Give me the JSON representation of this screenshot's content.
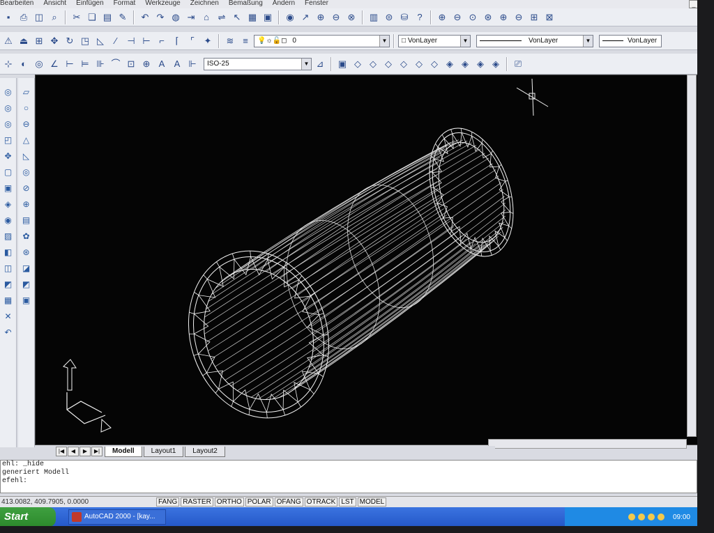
{
  "menu": [
    "Bearbeiten",
    "Ansicht",
    "Einfügen",
    "Format",
    "Werkzeuge",
    "Zeichnen",
    "Bemaßung",
    "Ändern",
    "Fenster"
  ],
  "toolbar": {
    "layer_icons": "💡☼🔓◻",
    "layer_value": "0",
    "color_value": "□ VonLayer",
    "linetype_value": "VonLayer",
    "lineweight_value": "VonLayer",
    "dimstyle_value": "ISO-25"
  },
  "tabs": [
    "Modell",
    "Layout1",
    "Layout2"
  ],
  "command": {
    "lines": [
      "ehl: _hide",
      "generiert Modell",
      "efehl:"
    ]
  },
  "status": {
    "coords": "413.0082, 409.7905, 0.0000",
    "toggles": [
      "FANG",
      "RASTER",
      "ORTHO",
      "POLAR",
      "OFANG",
      "OTRACK",
      "LST",
      "MODEL"
    ]
  },
  "taskbar": {
    "start": "Start",
    "task": "AutoCAD 2000 - [kay...",
    "clock": "09:00"
  },
  "colors": {
    "viewport_bg": "#050505",
    "wireframe": "#f2f2f2",
    "taskbar": "#2a5fcf",
    "start_button": "#34952f"
  }
}
